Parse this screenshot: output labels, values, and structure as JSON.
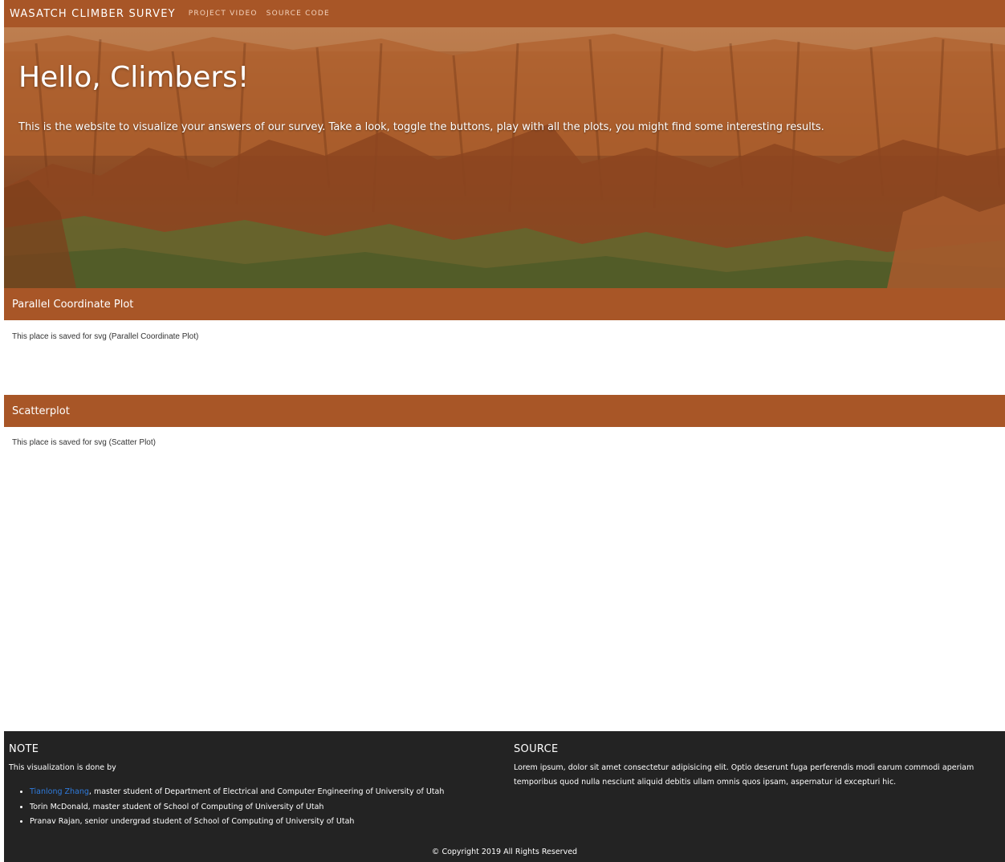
{
  "navbar": {
    "brand": "WASATCH CLIMBER SURVEY",
    "links": [
      "PROJECT VIDEO",
      "SOURCE CODE"
    ]
  },
  "hero": {
    "title": "Hello, Climbers!",
    "subtitle": "This is the website to visualize your answers of our survey. Take a look, toggle the buttons, play with all the plots, you might find some interesting results."
  },
  "sections": [
    {
      "title": "Parallel Coordinate Plot",
      "placeholder": "This place is saved for svg (Parallel Coordinate Plot)"
    },
    {
      "title": "Scatterplot",
      "placeholder": "This place is saved for svg (Scatter Plot)"
    }
  ],
  "footer": {
    "note_heading": "NOTE",
    "note_intro": "This visualization is done by",
    "contributors": [
      {
        "name": "Tianlong Zhang",
        "desc": ", master student of Department of Electrical and Computer Engineering of University of Utah"
      },
      {
        "name": "",
        "desc": "Torin McDonald, master student of School of Computing of University of Utah"
      },
      {
        "name": "",
        "desc": "Pranav Rajan, senior undergrad student of School of Computing of University of Utah"
      }
    ],
    "source_heading": "SOURCE",
    "source_text": "Lorem ipsum, dolor sit amet consectetur adipisicing elit. Optio deserunt fuga perferendis modi earum commodi aperiam temporibus quod nulla nesciunt aliquid debitis ullam omnis quos ipsam, aspernatur id excepturi hic.",
    "copyright": "© Copyright 2019 All Rights Reserved"
  },
  "colors": {
    "accent": "#a85627",
    "footer_bg": "#232323",
    "link": "#2f7bdc"
  }
}
